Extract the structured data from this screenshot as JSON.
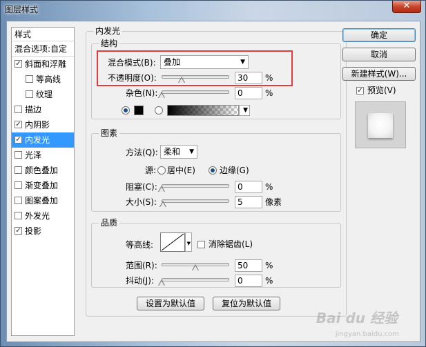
{
  "window": {
    "title": "图层样式",
    "close_glyph": "✕"
  },
  "style_list": {
    "header": "样式",
    "blend_options": "混合选项:自定",
    "items": [
      {
        "label": "斜面和浮雕",
        "checked": true,
        "indent": false,
        "selected": false
      },
      {
        "label": "等高线",
        "checked": false,
        "indent": true,
        "selected": false
      },
      {
        "label": "纹理",
        "checked": false,
        "indent": true,
        "selected": false
      },
      {
        "label": "描边",
        "checked": false,
        "indent": false,
        "selected": false
      },
      {
        "label": "内阴影",
        "checked": true,
        "indent": false,
        "selected": false
      },
      {
        "label": "内发光",
        "checked": true,
        "indent": false,
        "selected": true
      },
      {
        "label": "光泽",
        "checked": false,
        "indent": false,
        "selected": false
      },
      {
        "label": "颜色叠加",
        "checked": false,
        "indent": false,
        "selected": false
      },
      {
        "label": "渐变叠加",
        "checked": false,
        "indent": false,
        "selected": false
      },
      {
        "label": "图案叠加",
        "checked": false,
        "indent": false,
        "selected": false
      },
      {
        "label": "外发光",
        "checked": false,
        "indent": false,
        "selected": false
      },
      {
        "label": "投影",
        "checked": true,
        "indent": false,
        "selected": false
      }
    ]
  },
  "inner_glow": {
    "title": "内发光",
    "structure": {
      "title": "结构",
      "blend_mode_label": "混合模式(B):",
      "blend_mode_value": "叠加",
      "opacity_label": "不透明度(O):",
      "opacity_value": "30",
      "opacity_percent": 30,
      "noise_label": "杂色(N):",
      "noise_value": "0",
      "noise_percent": 0,
      "percent_sign": "%"
    },
    "elements": {
      "title": "图素",
      "technique_label": "方法(Q):",
      "technique_value": "柔和",
      "source_label": "源:",
      "center_label": "居中(E)",
      "edge_label": "边缘(G)",
      "choke_label": "阻塞(C):",
      "choke_value": "0",
      "choke_percent": 0,
      "size_label": "大小(S):",
      "size_value": "5",
      "size_unit": "像素",
      "percent_sign": "%"
    },
    "quality": {
      "title": "品质",
      "contour_label": "等高线:",
      "anti_alias_label": "消除锯齿(L)",
      "range_label": "范围(R):",
      "range_value": "50",
      "range_percent": 50,
      "jitter_label": "抖动(J):",
      "jitter_value": "0",
      "jitter_percent": 0,
      "percent_sign": "%"
    },
    "buttons": {
      "make_default": "设置为默认值",
      "reset_default": "复位为默认值"
    }
  },
  "right_panel": {
    "ok": "确定",
    "cancel": "取消",
    "new_style": "新建样式(W)...",
    "preview_label": "预览(V)",
    "preview_checked": true
  },
  "watermark": {
    "text": "Bai du 经验",
    "sub": "jingyan.baidu.com"
  },
  "colors": {
    "highlight": "#e23b3b",
    "selection": "#3399ff",
    "glow_color": "#000000"
  }
}
